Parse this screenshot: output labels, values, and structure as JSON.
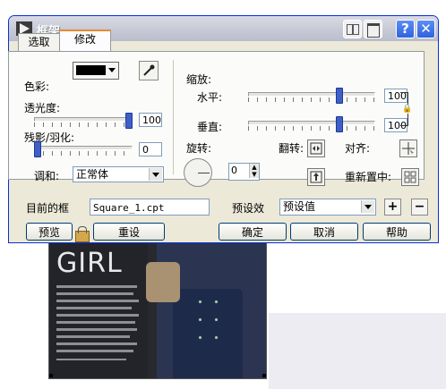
{
  "window": {
    "title": "框架"
  },
  "tabs": [
    {
      "label": "选取"
    },
    {
      "label": "修改"
    }
  ],
  "left": {
    "color_label": "色彩:",
    "color_value": "#000000",
    "opacity_label": "透光度:",
    "opacity_value": "100",
    "opacity_level": 1.0,
    "shadow_label": "残影/羽化:",
    "shadow_value": "0",
    "blend_label": "调和:",
    "blend_value": "正常体"
  },
  "right": {
    "scale_label": "缩放:",
    "horizontal_label": "水平:",
    "horizontal_value": "100",
    "vertical_label": "垂直:",
    "vertical_value": "100",
    "rotate_label": "旋转:",
    "rotate_value": "0",
    "flip_label": "翻转:",
    "align_label": "对齐:",
    "recenter_label": "重新置中:"
  },
  "bottom": {
    "current_frame_label": "目前的框",
    "current_frame_value": "Square_1.cpt",
    "preset_label": "预设效",
    "preset_value": "预设值",
    "add_label": "+",
    "remove_label": "−"
  },
  "buttons": {
    "preview": "预览",
    "reset": "重设",
    "ok": "确定",
    "cancel": "取消",
    "help": "帮助"
  },
  "photo": {
    "title": "GIRL"
  }
}
